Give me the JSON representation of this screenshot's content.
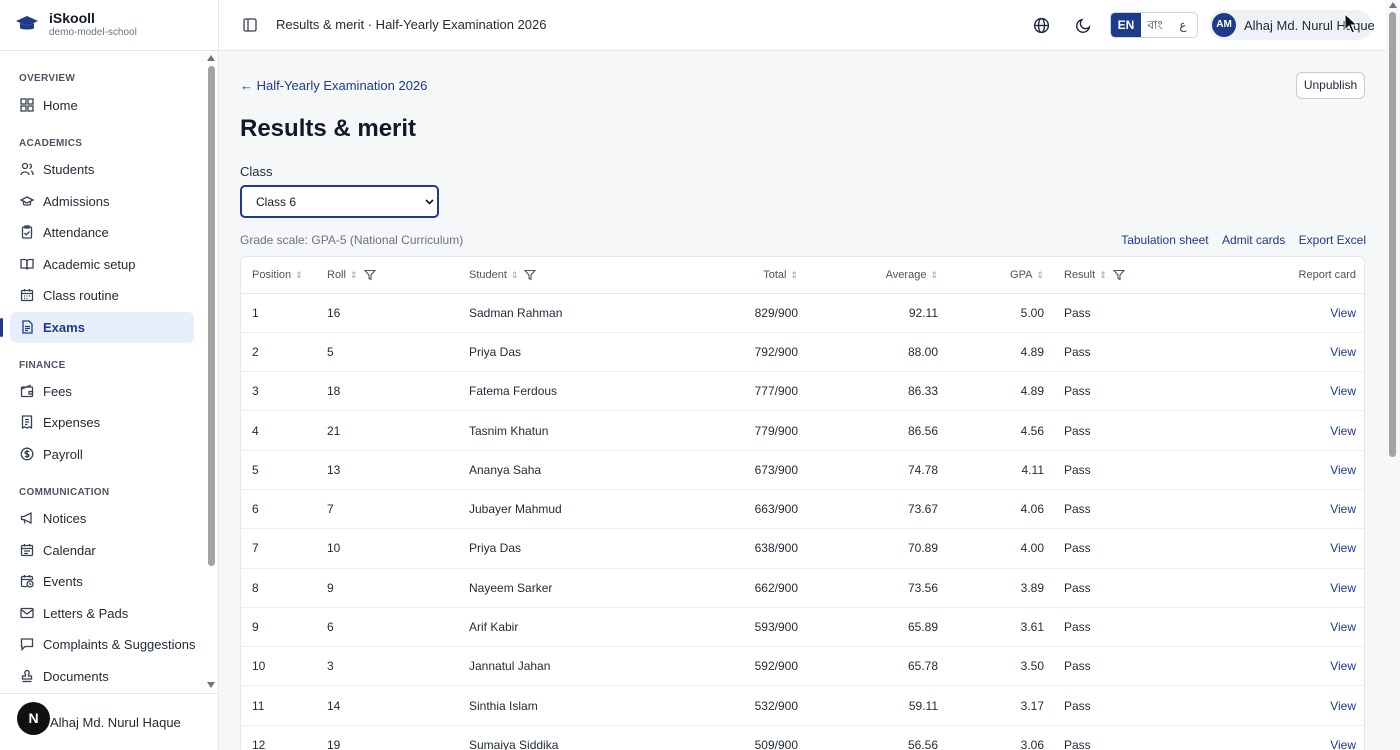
{
  "brand": {
    "name": "iSkooll",
    "subtitle": "demo-model-school"
  },
  "sidebar": {
    "sections": [
      {
        "label": "OVERVIEW"
      },
      {
        "label": "ACADEMICS"
      },
      {
        "label": "FINANCE"
      },
      {
        "label": "COMMUNICATION"
      }
    ],
    "items": [
      {
        "label": "Home",
        "icon": "dashboard-icon"
      },
      {
        "label": "Students",
        "icon": "users-icon"
      },
      {
        "label": "Admissions",
        "icon": "graduation-cap-icon"
      },
      {
        "label": "Attendance",
        "icon": "clipboard-check-icon"
      },
      {
        "label": "Academic setup",
        "icon": "book-open-icon"
      },
      {
        "label": "Class routine",
        "icon": "calendar-days-icon"
      },
      {
        "label": "Exams",
        "icon": "file-text-icon",
        "active": true
      },
      {
        "label": "Fees",
        "icon": "wallet-icon"
      },
      {
        "label": "Expenses",
        "icon": "receipt-icon"
      },
      {
        "label": "Payroll",
        "icon": "dollar-circle-icon"
      },
      {
        "label": "Notices",
        "icon": "megaphone-icon"
      },
      {
        "label": "Calendar",
        "icon": "calendar-icon"
      },
      {
        "label": "Events",
        "icon": "calendar-clock-icon"
      },
      {
        "label": "Letters & Pads",
        "icon": "mail-icon"
      },
      {
        "label": "Complaints & Suggestions",
        "icon": "message-square-icon"
      },
      {
        "label": "Documents",
        "icon": "stamp-icon"
      }
    ],
    "footer_user": {
      "initial": "N",
      "name": "Alhaj Md. Nurul Haque"
    }
  },
  "topbar": {
    "breadcrumb": "Results & merit · Half-Yearly Examination 2026",
    "languages": {
      "en": "EN",
      "bn": "বাং",
      "ar": "ع"
    },
    "user": {
      "initials": "AM",
      "name": "Alhaj Md. Nurul Haque"
    }
  },
  "main": {
    "back_link": "← Half-Yearly Examination 2026",
    "unpublish_label": "Unpublish",
    "title": "Results & merit",
    "class_label": "Class",
    "class_selected": "Class 6",
    "grade_scale": "Grade scale: GPA-5 (National Curriculum)",
    "actions": {
      "tabulation": "Tabulation sheet",
      "admit": "Admit cards",
      "export": "Export Excel"
    },
    "table": {
      "headers": {
        "position": "Position",
        "roll": "Roll",
        "student": "Student",
        "total": "Total",
        "average": "Average",
        "gpa": "GPA",
        "result": "Result",
        "report": "Report card"
      },
      "rows": [
        {
          "position": "1",
          "roll": "16",
          "student": "Sadman Rahman",
          "total": "829/900",
          "average": "92.11",
          "gpa": "5.00",
          "result": "Pass",
          "report": "View"
        },
        {
          "position": "2",
          "roll": "5",
          "student": "Priya Das",
          "total": "792/900",
          "average": "88.00",
          "gpa": "4.89",
          "result": "Pass",
          "report": "View"
        },
        {
          "position": "3",
          "roll": "18",
          "student": "Fatema Ferdous",
          "total": "777/900",
          "average": "86.33",
          "gpa": "4.89",
          "result": "Pass",
          "report": "View"
        },
        {
          "position": "4",
          "roll": "21",
          "student": "Tasnim Khatun",
          "total": "779/900",
          "average": "86.56",
          "gpa": "4.56",
          "result": "Pass",
          "report": "View"
        },
        {
          "position": "5",
          "roll": "13",
          "student": "Ananya Saha",
          "total": "673/900",
          "average": "74.78",
          "gpa": "4.11",
          "result": "Pass",
          "report": "View"
        },
        {
          "position": "6",
          "roll": "7",
          "student": "Jubayer Mahmud",
          "total": "663/900",
          "average": "73.67",
          "gpa": "4.06",
          "result": "Pass",
          "report": "View"
        },
        {
          "position": "7",
          "roll": "10",
          "student": "Priya Das",
          "total": "638/900",
          "average": "70.89",
          "gpa": "4.00",
          "result": "Pass",
          "report": "View"
        },
        {
          "position": "8",
          "roll": "9",
          "student": "Nayeem Sarker",
          "total": "662/900",
          "average": "73.56",
          "gpa": "3.89",
          "result": "Pass",
          "report": "View"
        },
        {
          "position": "9",
          "roll": "6",
          "student": "Arif Kabir",
          "total": "593/900",
          "average": "65.89",
          "gpa": "3.61",
          "result": "Pass",
          "report": "View"
        },
        {
          "position": "10",
          "roll": "3",
          "student": "Jannatul Jahan",
          "total": "592/900",
          "average": "65.78",
          "gpa": "3.50",
          "result": "Pass",
          "report": "View"
        },
        {
          "position": "11",
          "roll": "14",
          "student": "Sinthia Islam",
          "total": "532/900",
          "average": "59.11",
          "gpa": "3.17",
          "result": "Pass",
          "report": "View"
        },
        {
          "position": "12",
          "roll": "19",
          "student": "Sumaiya Siddika",
          "total": "509/900",
          "average": "56.56",
          "gpa": "3.06",
          "result": "Pass",
          "report": "View"
        }
      ]
    }
  },
  "colors": {
    "accent": "#1e3a8a",
    "active_bg": "#e8eefb",
    "border": "#e5e7eb"
  }
}
